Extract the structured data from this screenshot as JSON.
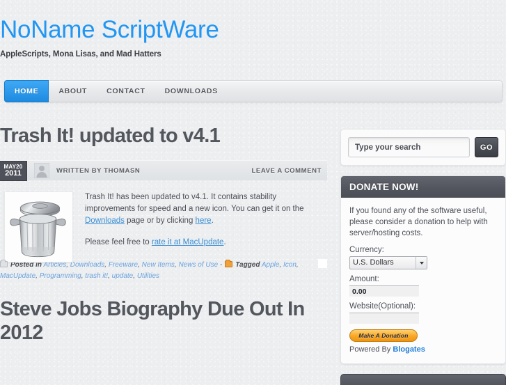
{
  "site": {
    "title": "NoName ScriptWare",
    "description": "AppleScripts, Mona Lisas, and Mad Hatters",
    "title_color": "#2196f3"
  },
  "nav": {
    "items": [
      {
        "label": "HOME",
        "active": true
      },
      {
        "label": "ABOUT",
        "active": false
      },
      {
        "label": "CONTACT",
        "active": false
      },
      {
        "label": "DOWNLOADS",
        "active": false
      }
    ]
  },
  "post": {
    "title": "Trash It! updated to v4.1",
    "date_month_day": "MAY20",
    "date_year": "2011",
    "author_line": "WRITTEN BY THOMASN",
    "comment_link": "LEAVE A COMMENT",
    "thumb_icon": "trash-can-icon",
    "paragraph1_part1": "Trash It! has been updated to v4.1. It contains stability improvements for speed and a new icon. You can get it on the ",
    "paragraph1_link1": "Downloads",
    "paragraph1_part2": " page or by clicking ",
    "paragraph1_link2": "here",
    "paragraph1_part3": ".",
    "paragraph2_part1": "Please feel free to ",
    "paragraph2_link": "rate it at MacUpdate",
    "paragraph2_part2": ".",
    "posted_in_label": "Posted in",
    "categories": [
      "Articles",
      "Downloads",
      "Freeware",
      "New Items",
      "News of Use"
    ],
    "separator": "-",
    "tagged_label": "Tagged",
    "tags": [
      "Apple",
      "Icon",
      "MacUpdate",
      "Programming",
      "trash it!",
      "update",
      "Utilities"
    ]
  },
  "post2": {
    "title": "Steve Jobs Biography Due Out In 2012"
  },
  "search": {
    "placeholder": "Type your search",
    "value": "",
    "button_label": "GO"
  },
  "donate": {
    "heading": "DONATE NOW!",
    "body": "If you found any of the software useful, please consider a donation to help with server/hosting costs.",
    "currency_label": "Currency:",
    "currency_value": "U.S. Dollars",
    "currency_options": [
      "U.S. Dollars"
    ],
    "amount_label": "Amount:",
    "amount_value": "0.00",
    "website_label": "Website(Optional):",
    "website_value": "",
    "button_label": "Make A Donation",
    "powered_prefix": "Powered By ",
    "powered_link": "Blogates"
  }
}
